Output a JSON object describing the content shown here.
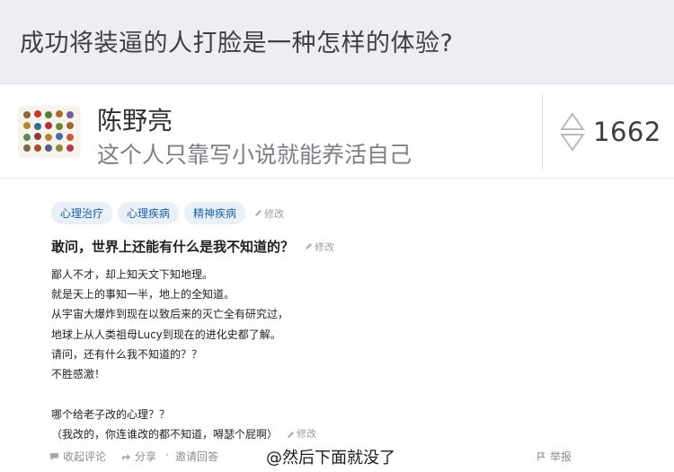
{
  "question": {
    "title": "成功将装逼的人打脸是一种怎样的体验?"
  },
  "author": {
    "name": "陈野亮",
    "bio": "这个人只靠写小说就能养活自己",
    "votes": "1662"
  },
  "tags": [
    "心理治疗",
    "心理疾病",
    "精神疾病"
  ],
  "edit_label": "修改",
  "answer": {
    "title": "敢问，世界上还能有什么是我不知道的？",
    "lines": [
      "鄙人不才，却上知天文下知地理。",
      "就是天上的事知一半，地上的全知道。",
      "从宇宙大爆炸到现在以致后来的灭亡全有研究过，",
      "地球上从人类祖母Lucy到现在的进化史都了解。",
      "请问，还有什么我不知道的？？",
      "不胜感激！",
      "",
      "哪个给老子改的心理？？",
      "（我改的，你连谁改的都不知道，嘚瑟个屁啊）"
    ]
  },
  "footer": {
    "collapse_comments": "收起评论",
    "share": "分享",
    "invite": "邀请回答",
    "report": "举报"
  },
  "watermark": "@然后下面就没了",
  "icons": {
    "vote": "up-down-triangle-icon",
    "edit": "pencil-icon",
    "comment": "comment-icon",
    "share": "share-icon",
    "report": "flag-icon"
  }
}
